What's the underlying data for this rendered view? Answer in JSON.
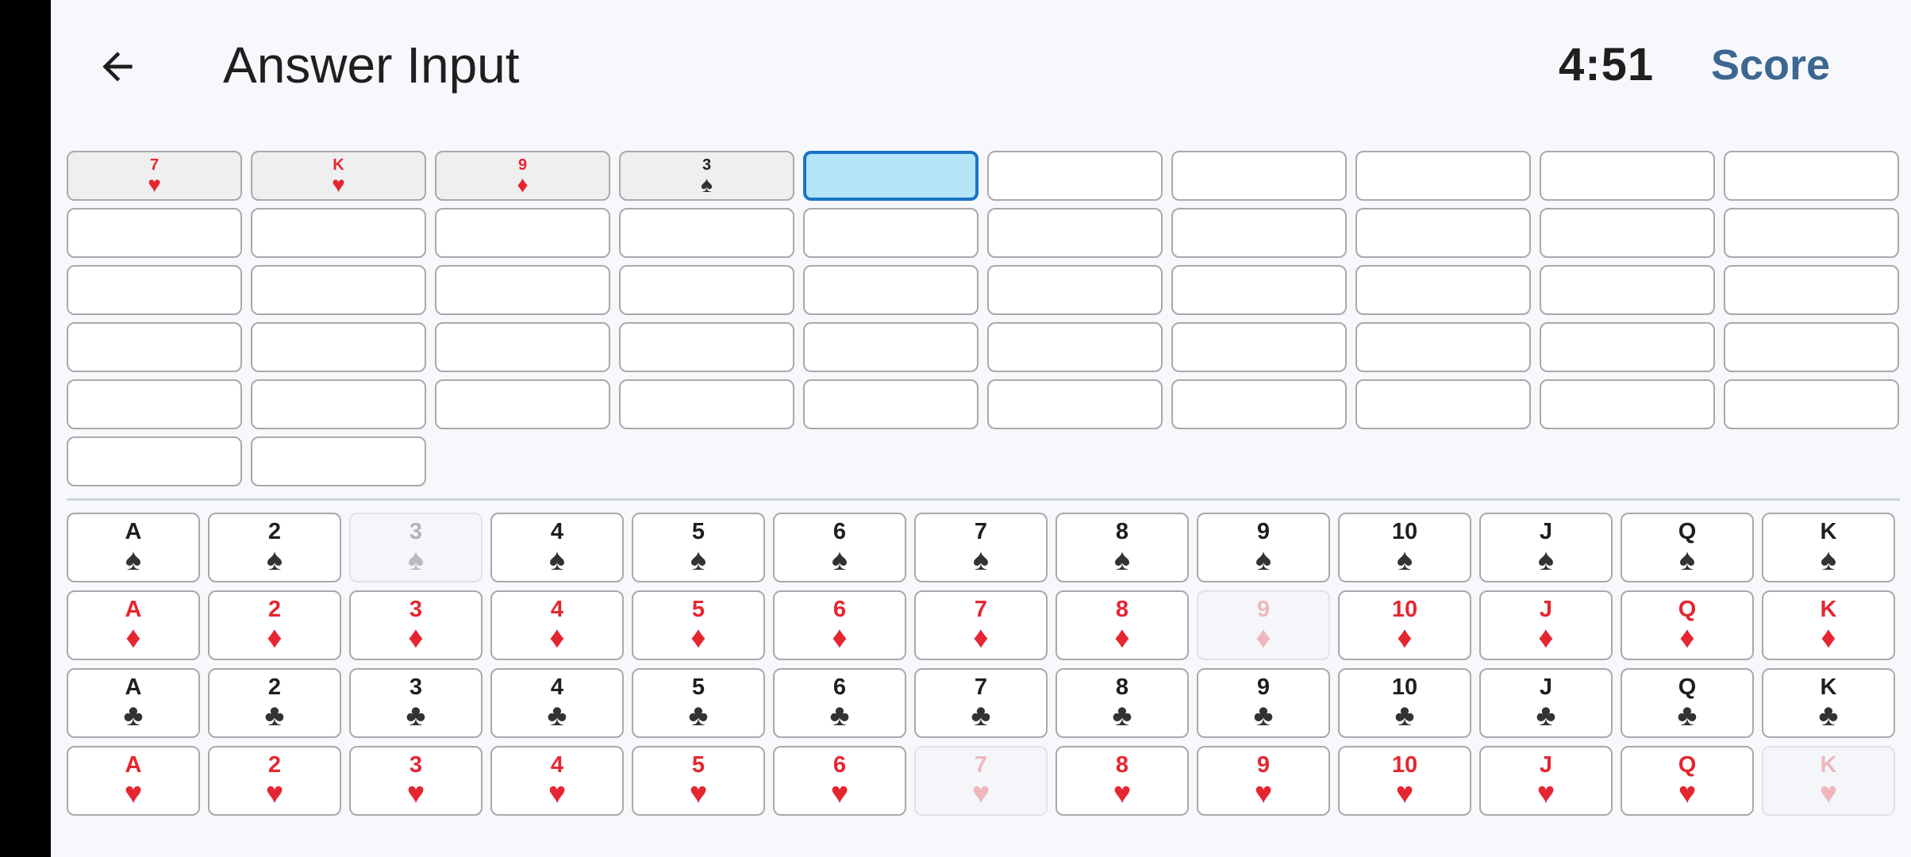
{
  "header": {
    "title": "Answer Input",
    "timer": "4:51",
    "score_label": "Score"
  },
  "colors": {
    "red": "#e52630",
    "black": "#333333",
    "accent": "#3c6790",
    "active_fill": "#b5e3f8",
    "active_border": "#1a73c7"
  },
  "answer_slots": {
    "total": 52,
    "active_index": 4,
    "filled": [
      {
        "rank": "7",
        "suit": "hearts",
        "symbol": "♥"
      },
      {
        "rank": "K",
        "suit": "hearts",
        "symbol": "♥"
      },
      {
        "rank": "9",
        "suit": "diamonds",
        "symbol": "♦"
      },
      {
        "rank": "3",
        "suit": "spades",
        "symbol": "♠"
      }
    ]
  },
  "picker": {
    "ranks": [
      "A",
      "2",
      "3",
      "4",
      "5",
      "6",
      "7",
      "8",
      "9",
      "10",
      "J",
      "Q",
      "K"
    ],
    "suits": [
      {
        "name": "spades",
        "symbol": "♠",
        "color": "black"
      },
      {
        "name": "diamonds",
        "symbol": "♦",
        "color": "red"
      },
      {
        "name": "clubs",
        "symbol": "♣",
        "color": "black"
      },
      {
        "name": "hearts",
        "symbol": "♥",
        "color": "red"
      }
    ],
    "used": [
      "3-spades",
      "9-diamonds",
      "7-hearts",
      "K-hearts"
    ]
  }
}
